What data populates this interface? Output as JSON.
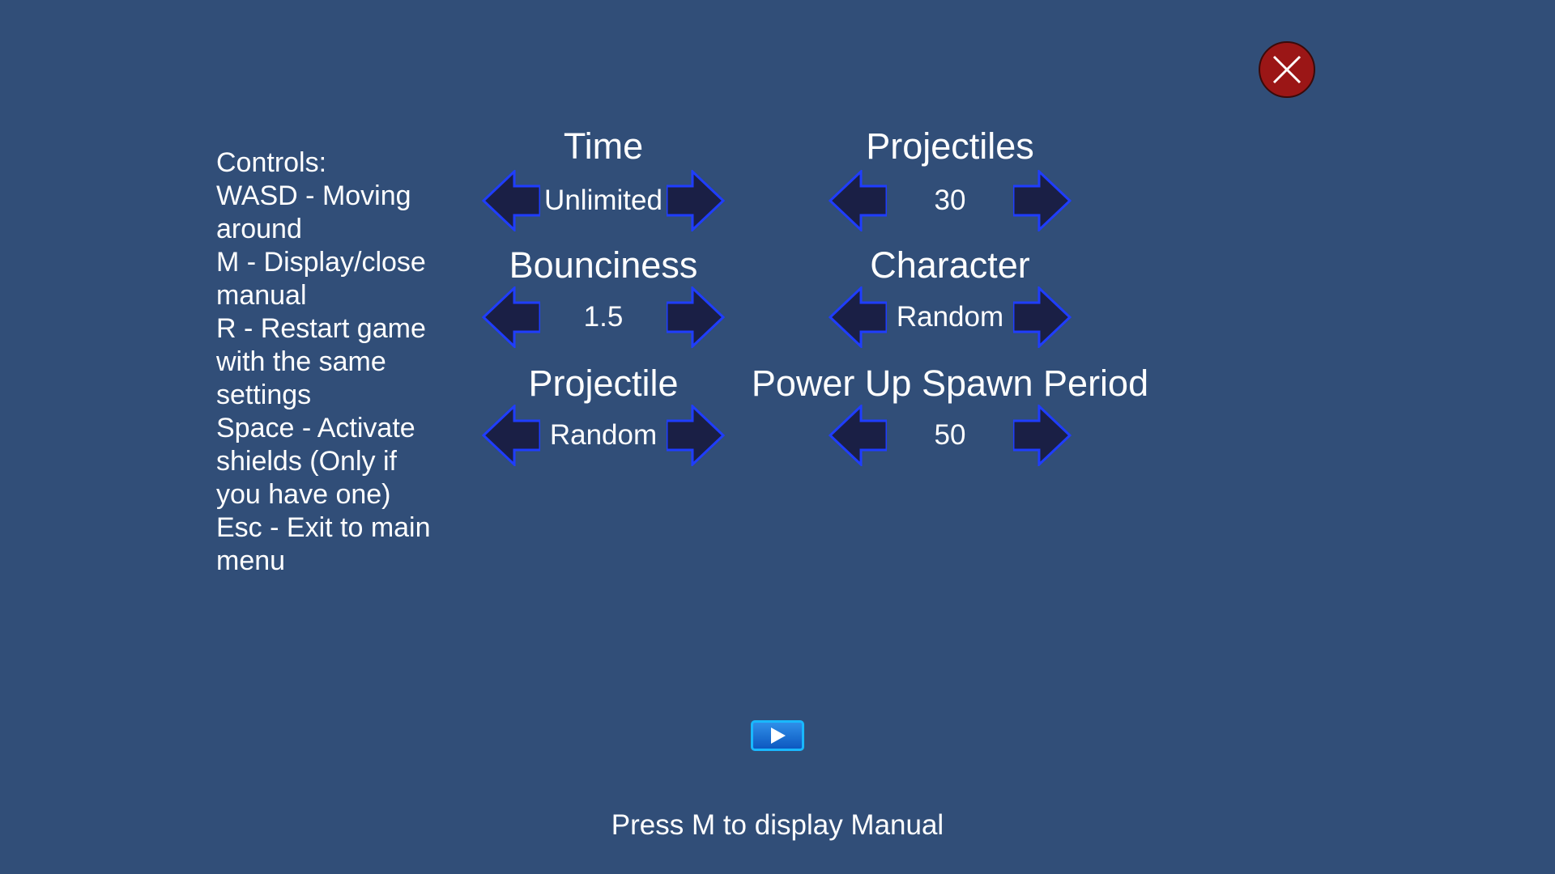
{
  "close_icon": "close-icon",
  "controls": [
    "Controls:",
    "WASD - Moving\naround",
    "M - Display/close\nmanual",
    "R - Restart game\nwith the same\nsettings",
    "Space - Activate\nshields (Only if\nyou have one)",
    "Esc - Exit to main\nmenu"
  ],
  "settings": {
    "time": {
      "title": "Time",
      "value": "Unlimited"
    },
    "projectiles": {
      "title": "Projectiles",
      "value": "30"
    },
    "bounciness": {
      "title": "Bounciness",
      "value": "1.5"
    },
    "character": {
      "title": "Character",
      "value": "Random"
    },
    "projectile": {
      "title": "Projectile",
      "value": "Random"
    },
    "power_up_spawn_period": {
      "title": "Power Up Spawn Period",
      "value": "50"
    }
  },
  "play_icon": "play-icon",
  "hint": "Press M to display Manual",
  "colors": {
    "background": "#314e78",
    "close_button": "#9b1616",
    "arrow_fill": "#1a1f45",
    "arrow_outline": "#1f3dff",
    "play_button": "#1a78d8"
  }
}
